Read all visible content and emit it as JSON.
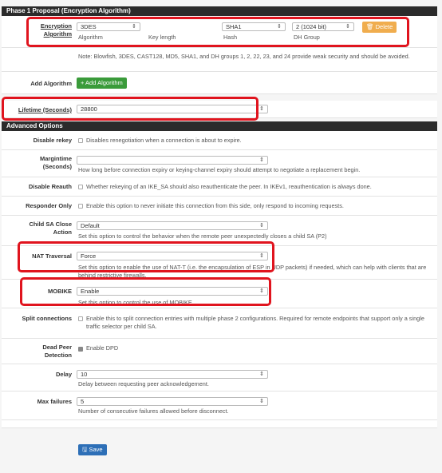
{
  "phase1": {
    "header": "Phase 1 Proposal (Encryption Algorithm)",
    "enc_label": "Encryption Algorithm",
    "algorithm_value": "3DES",
    "algorithm_caption": "Algorithm",
    "keylen_caption": "Key length",
    "hash_value": "SHA1",
    "hash_caption": "Hash",
    "dh_value": "2 (1024 bit)",
    "dh_caption": "DH Group",
    "delete_label": "Delete",
    "note": "Note: Blowfish, 3DES, CAST128, MD5, SHA1, and DH groups 1, 2, 22, 23, and 24 provide weak security and should be avoided.",
    "add_algo_label": "Add Algorithm",
    "add_algo_button": "+ Add Algorithm",
    "lifetime_label": "Lifetime (Seconds)",
    "lifetime_value": "28800"
  },
  "advanced": {
    "header": "Advanced Options",
    "disable_rekey_label": "Disable rekey",
    "disable_rekey_help": "Disables renegotiation when a connection is about to expire.",
    "margintime_label_1": "Margintime",
    "margintime_label_2": "(Seconds)",
    "margintime_value": "",
    "margintime_help": "How long before connection expiry or keying-channel expiry should attempt to negotiate a replacement begin.",
    "disable_reauth_label": "Disable Reauth",
    "disable_reauth_help": "Whether rekeying of an IKE_SA should also reauthenticate the peer. In IKEv1, reauthentication is always done.",
    "responder_label": "Responder Only",
    "responder_help": "Enable this option to never initiate this connection from this side, only respond to incoming requests.",
    "childsa_label_1": "Child SA Close",
    "childsa_label_2": "Action",
    "childsa_value": "Default",
    "childsa_help": "Set this option to control the behavior when the remote peer unexpectedly closes a child SA (P2)",
    "nat_label": "NAT Traversal",
    "nat_value": "Force",
    "nat_help": "Set this option to enable the use of NAT-T (i.e. the encapsulation of ESP in UDP packets) if needed, which can help with clients that are behind restrictive firewalls.",
    "mobike_label": "MOBIKE",
    "mobike_value": "Enable",
    "mobike_help": "Set this option to control the use of MOBIKE",
    "split_label": "Split connections",
    "split_help": "Enable this to split connection entries with multiple phase 2 configurations. Required for remote endpoints that support only a single traffic selector per child SA.",
    "dpd_label_1": "Dead Peer",
    "dpd_label_2": "Detection",
    "dpd_help": "Enable DPD",
    "delay_label": "Delay",
    "delay_value": "10",
    "delay_help": "Delay between requesting peer acknowledgement.",
    "maxfail_label": "Max failures",
    "maxfail_value": "5",
    "maxfail_help": "Number of consecutive failures allowed before disconnect."
  },
  "save_label": "Save",
  "icons": {
    "delete": "trash-icon",
    "save": "floppy-disk-icon",
    "caret": "updown-caret-icon"
  },
  "colors": {
    "highlight": "#e0141e",
    "header_bg": "#2b2b2b",
    "green": "#3a9b3a",
    "orange": "#f0ad4e",
    "blue": "#2d6fb7"
  }
}
